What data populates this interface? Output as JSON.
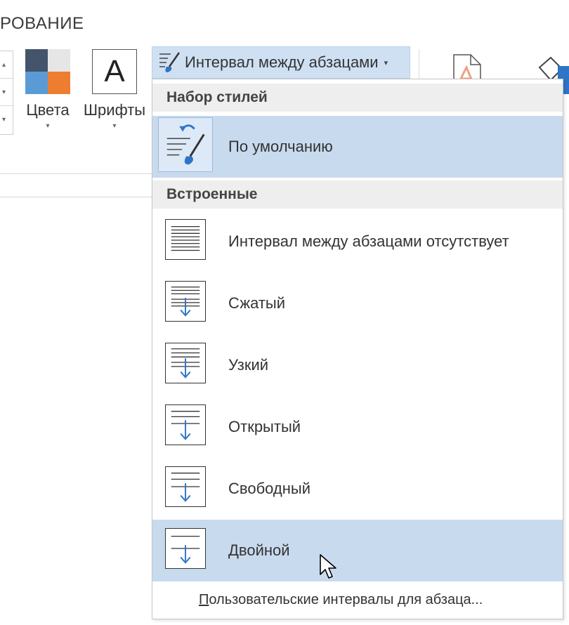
{
  "ribbon": {
    "tab_title": "РОВАНИЕ",
    "colors_label": "Цвета",
    "fonts_label": "Шрифты",
    "fonts_glyph": "A",
    "caret": "▾",
    "spacing_button_label": "Интервал между абзацами"
  },
  "dropdown": {
    "section_style_set": "Набор стилей",
    "default_item": "По умолчанию",
    "section_builtin": "Встроенные",
    "items": [
      {
        "label": "Интервал между абзацами отсутствует",
        "icon": "no-spacing-icon"
      },
      {
        "label": "Сжатый",
        "icon": "compact-spacing-icon"
      },
      {
        "label": "Узкий",
        "icon": "tight-spacing-icon"
      },
      {
        "label": "Открытый",
        "icon": "open-spacing-icon"
      },
      {
        "label": "Свободный",
        "icon": "relaxed-spacing-icon"
      },
      {
        "label": "Двойной",
        "icon": "double-spacing-icon"
      }
    ],
    "custom_spacing_underlined": "П",
    "custom_spacing_rest": "ользовательские интервалы для абзаца..."
  },
  "colors": {
    "selected_bg": "#c8daee",
    "accent_blue": "#2e74c7",
    "header_bg": "#eeeeee"
  }
}
